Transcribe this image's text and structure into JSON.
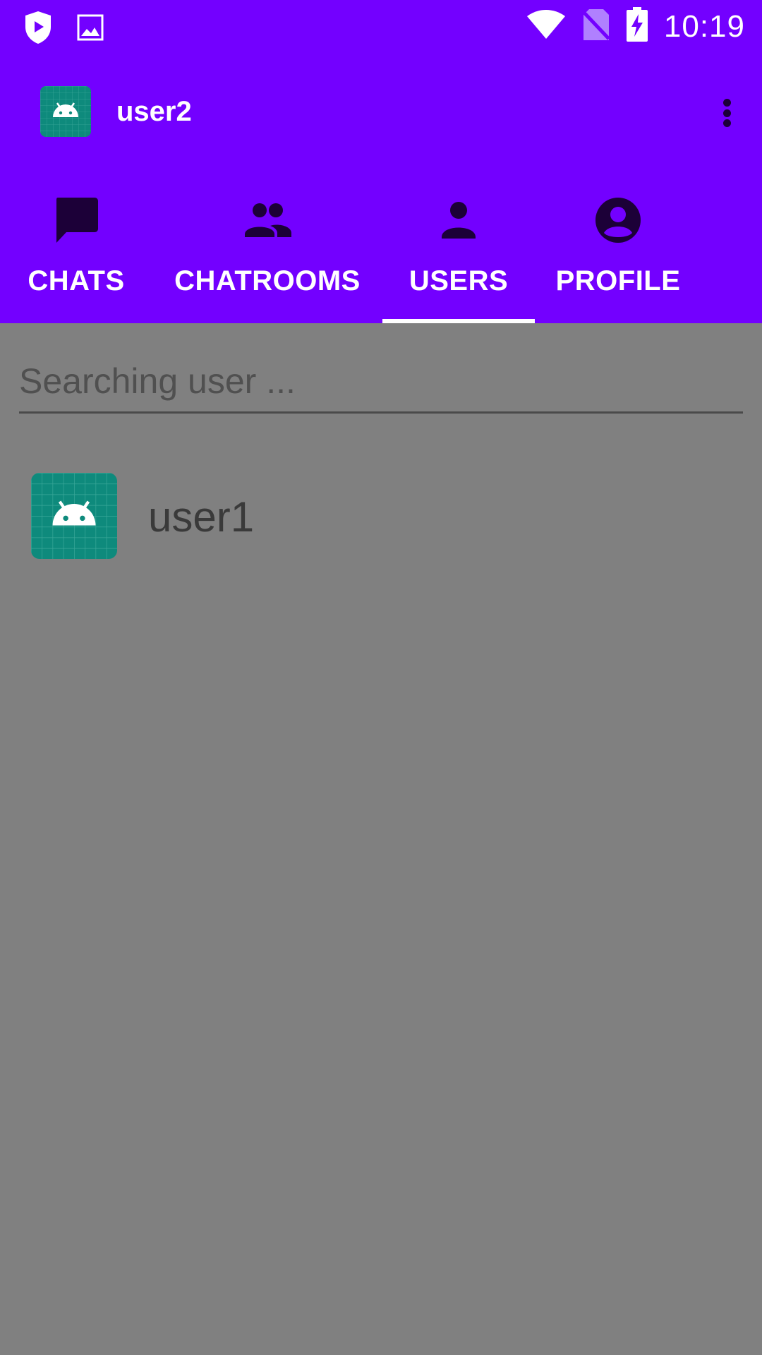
{
  "status_bar": {
    "time": "10:19",
    "left_icons": [
      "shield-play-icon",
      "image-icon"
    ],
    "right_icons": [
      "wifi-icon",
      "no-sim-icon",
      "battery-charging-icon"
    ]
  },
  "app_bar": {
    "title": "user2",
    "logo": "android-logo",
    "menu_icon": "more-vert-icon"
  },
  "tabs": [
    {
      "label": "CHATS",
      "icon": "chat-icon",
      "selected": false
    },
    {
      "label": "CHATROOMS",
      "icon": "group-icon",
      "selected": false
    },
    {
      "label": "USERS",
      "icon": "person-icon",
      "selected": true
    },
    {
      "label": "PROFILE",
      "icon": "account-circle-icon",
      "selected": false
    }
  ],
  "search": {
    "placeholder": "Searching user ...",
    "value": ""
  },
  "users": [
    {
      "name": "user1",
      "avatar": "android-logo"
    }
  ],
  "colors": {
    "primary": "#7300FF",
    "indicator": "#ffffff",
    "scrim_background": "#808080",
    "avatar_bg": "#0E8A7C"
  }
}
